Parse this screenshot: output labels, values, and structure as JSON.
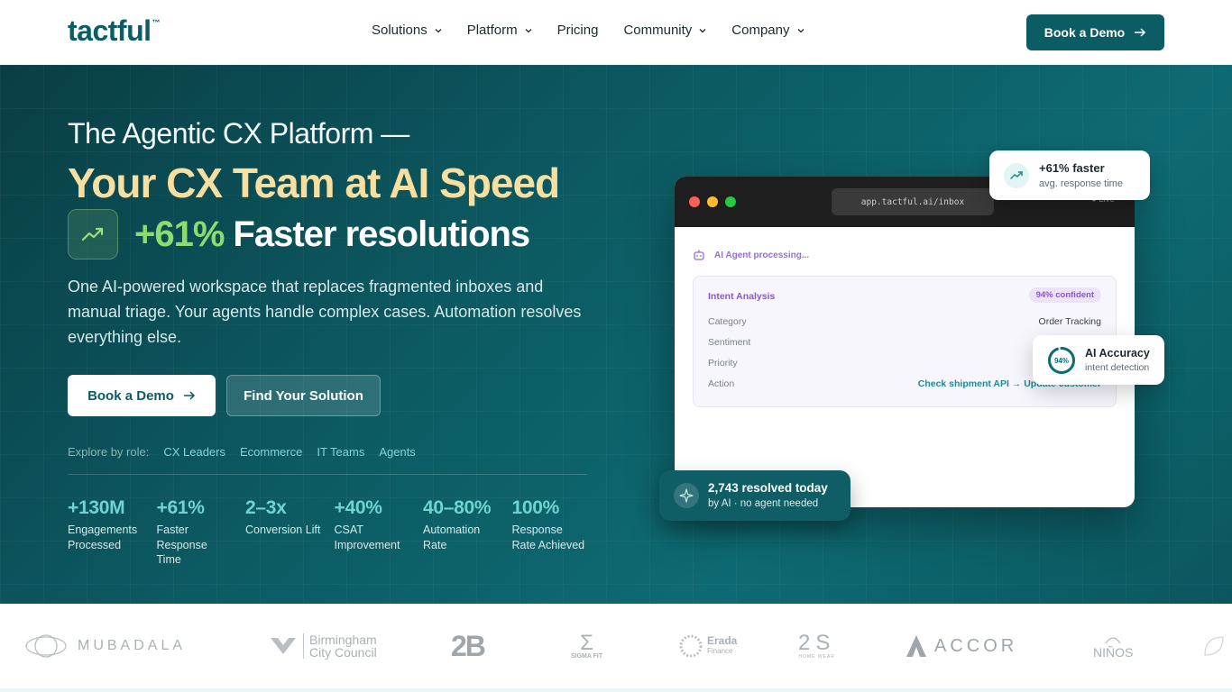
{
  "nav": {
    "logo": "tactful",
    "logo_tm": "™",
    "links": [
      "Solutions",
      "Platform",
      "Pricing",
      "Community",
      "Company"
    ],
    "cta": "Book a Demo"
  },
  "hero": {
    "line1": "The Agentic CX Platform —",
    "line2": "Your CX Team at AI Speed",
    "line3_num": "+61%",
    "line3_text": "Faster resolutions",
    "lead": "One AI-powered workspace that replaces fragmented inboxes and manual triage. Your agents handle complex cases. Automation resolves everything else.",
    "btn_primary": "Book a Demo",
    "btn_secondary": "Find Your Solution",
    "roles_label": "Explore by role:",
    "roles": [
      "CX Leaders",
      "Ecommerce",
      "IT Teams",
      "Agents"
    ],
    "stats": [
      {
        "value": "+130M",
        "label": "Engagements Processed"
      },
      {
        "value": "+61%",
        "label": "Faster Response Time"
      },
      {
        "value": "2–3x",
        "label": "Conversion Lift"
      },
      {
        "value": "+40%",
        "label": "CSAT Improvement"
      },
      {
        "value": "40–80%",
        "label": "Automation Rate"
      },
      {
        "value": "100%",
        "label": "Response Rate Achieved"
      }
    ]
  },
  "window": {
    "url": "app.tactful.ai/inbox",
    "live": "● Live",
    "agent_status": "AI Agent processing...",
    "intent_title": "Intent Analysis",
    "confidence": "94% confident",
    "rows": [
      {
        "k": "Category",
        "v": "Order Tracking"
      },
      {
        "k": "Sentiment",
        "v": ""
      },
      {
        "k": "Priority",
        "v": ""
      },
      {
        "k": "Action",
        "v": "Check shipment API → Update customer"
      }
    ]
  },
  "cards": {
    "faster_title": "+61% faster",
    "faster_sub": "avg. response time",
    "accuracy_pct": "94%",
    "accuracy_value": 0.94,
    "accuracy_title": "AI Accuracy",
    "accuracy_sub": "intent detection",
    "resolved_title": "2,743 resolved today",
    "resolved_sub": "by AI · no agent needed"
  },
  "partners": {
    "mubadala": "MUBADALA",
    "birmingham_1": "Birmingham",
    "birmingham_2": "City Council",
    "zb": "2B",
    "sigma": "SIGMA FIT",
    "erada_1": "Erada",
    "erada_2": "Finance",
    "twos": "2S",
    "twos_sub": "HOME WEAR",
    "accor": "ACCOR",
    "ninos": "NIÑOS"
  },
  "colors": {
    "brand": "#0b5c63",
    "gold": "#f6dfa0",
    "green": "#8edc6f",
    "teal_stat": "#6fd3d0",
    "purple": "#8a55d6"
  }
}
